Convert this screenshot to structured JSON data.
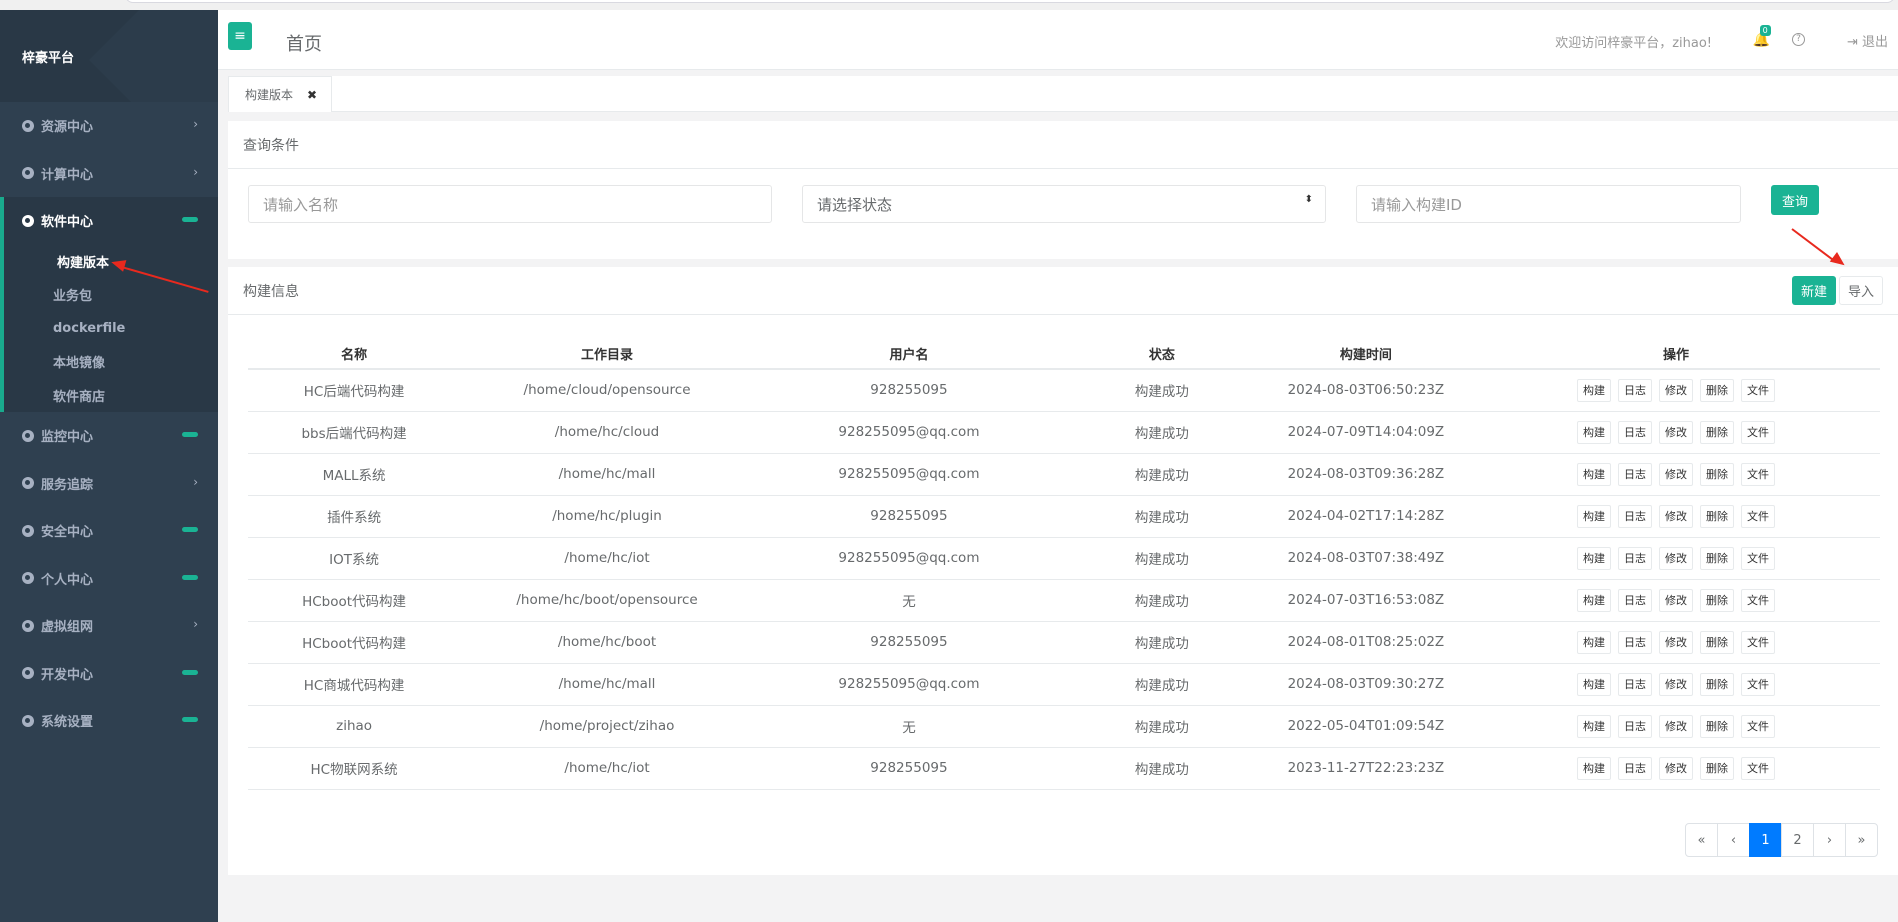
{
  "app": {
    "brand": "梓豪平台"
  },
  "sidebar": {
    "items_before": [
      {
        "label": "资源中心",
        "suffix": "›"
      },
      {
        "label": "计算中心",
        "suffix": "›"
      }
    ],
    "open_group": {
      "label": "软件中心",
      "children": [
        "构建版本",
        "业务包",
        "dockerfile",
        "本地镜像",
        "软件商店"
      ]
    },
    "items_after": [
      {
        "label": "监控中心",
        "suffix": "pill"
      },
      {
        "label": "服务追踪",
        "suffix": "›"
      },
      {
        "label": "安全中心",
        "suffix": "pill"
      },
      {
        "label": "个人中心",
        "suffix": "pill"
      },
      {
        "label": "虚拟组网",
        "suffix": "›"
      },
      {
        "label": "开发中心",
        "suffix": "pill"
      },
      {
        "label": "系统设置",
        "suffix": "pill"
      }
    ],
    "accent_color": "#1ab394"
  },
  "topbar": {
    "menu_icon": "≡",
    "home_label": "首页",
    "welcome": "欢迎访问梓豪平台，zihao!",
    "notification_count": "0",
    "help_icon": "?",
    "logout_label": "退出"
  },
  "tabs": [
    {
      "label": "构建版本",
      "close": "✖"
    }
  ],
  "query": {
    "title": "查询条件",
    "name_placeholder": "请输入名称",
    "status_placeholder": "请选择状态",
    "status_caret": "⬍",
    "id_placeholder": "请输入构建ID",
    "search_button": "查询"
  },
  "list": {
    "title": "构建信息",
    "new_button": "新建",
    "import_button": "导入",
    "columns": [
      "名称",
      "工作目录",
      "用户名",
      "状态",
      "构建时间",
      "操作"
    ],
    "actions": [
      "构建",
      "日志",
      "修改",
      "删除",
      "文件"
    ],
    "rows": [
      [
        "HC后端代码构建",
        "/home/cloud/opensource",
        "928255095",
        "构建成功",
        "2024-08-03T06:50:23Z"
      ],
      [
        "bbs后端代码构建",
        "/home/hc/cloud",
        "928255095@qq.com",
        "构建成功",
        "2024-07-09T14:04:09Z"
      ],
      [
        "MALL系统",
        "/home/hc/mall",
        "928255095@qq.com",
        "构建成功",
        "2024-08-03T09:36:28Z"
      ],
      [
        "插件系统",
        "/home/hc/plugin",
        "928255095",
        "构建成功",
        "2024-04-02T17:14:28Z"
      ],
      [
        "IOT系统",
        "/home/hc/iot",
        "928255095@qq.com",
        "构建成功",
        "2024-08-03T07:38:49Z"
      ],
      [
        "HCboot代码构建",
        "/home/hc/boot/opensource",
        "无",
        "构建成功",
        "2024-07-03T16:53:08Z"
      ],
      [
        "HCboot代码构建",
        "/home/hc/boot",
        "928255095",
        "构建成功",
        "2024-08-01T08:25:02Z"
      ],
      [
        "HC商城代码构建",
        "/home/hc/mall",
        "928255095@qq.com",
        "构建成功",
        "2024-08-03T09:30:27Z"
      ],
      [
        "zihao",
        "/home/project/zihao",
        "无",
        "构建成功",
        "2022-05-04T01:09:54Z"
      ],
      [
        "HC物联网系统",
        "/home/hc/iot",
        "928255095",
        "构建成功",
        "2023-11-27T22:23:23Z"
      ]
    ]
  },
  "pagination": {
    "first": "«",
    "prev": "‹",
    "pages": [
      "1",
      "2"
    ],
    "current": "1",
    "next": "›",
    "last": "»"
  },
  "annotation_color": "#e8291e"
}
